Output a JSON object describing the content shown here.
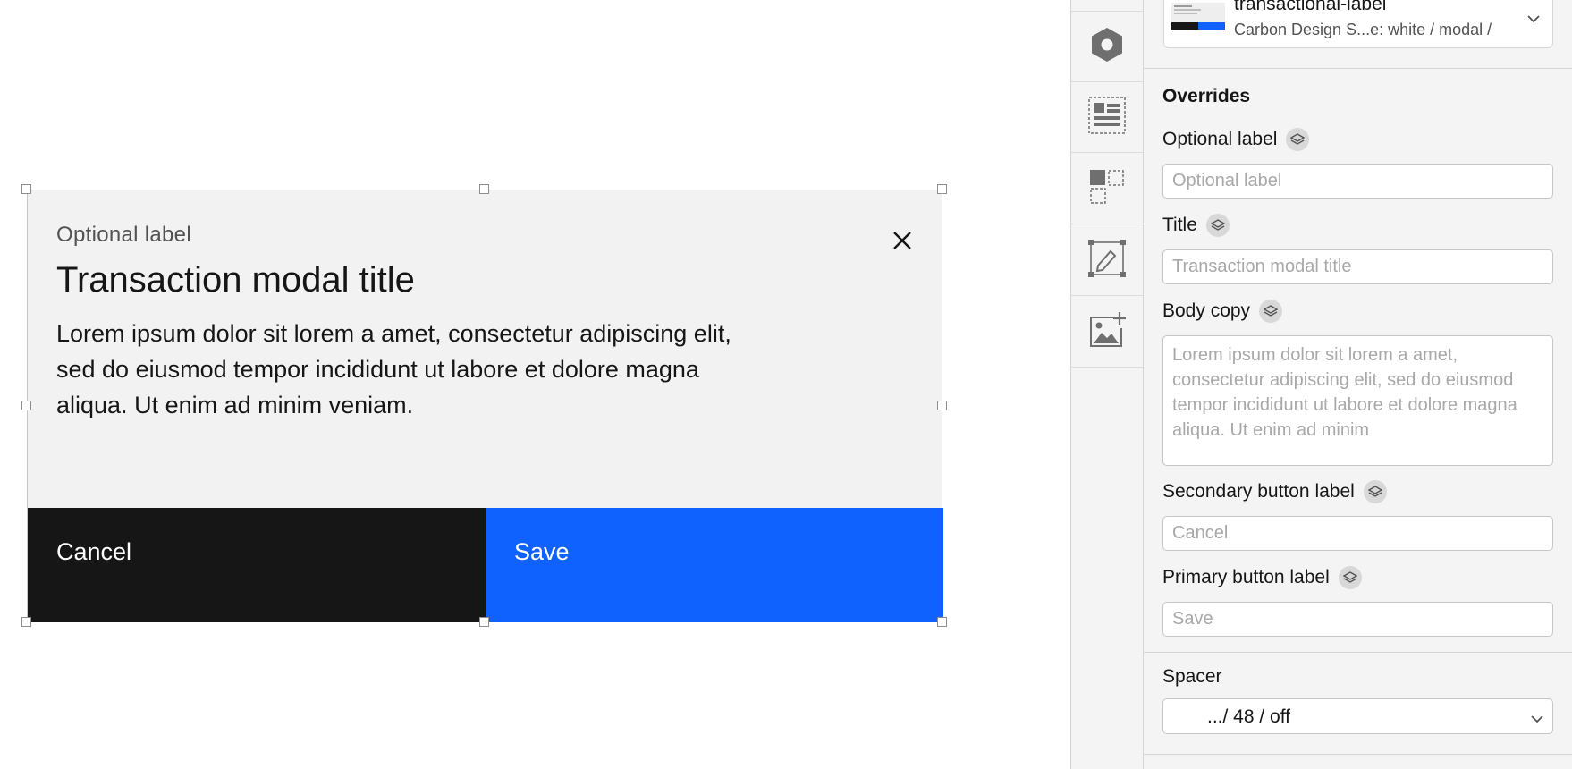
{
  "modal": {
    "optional_label": "Optional label",
    "title": "Transaction modal title",
    "body": "Lorem ipsum dolor sit lorem a amet, consectetur adipiscing elit, sed do eiusmod tempor incididunt ut labore et dolore magna aliqua. Ut enim ad minim veniam.",
    "secondary_button": "Cancel",
    "primary_button": "Save",
    "close_icon": "close-icon"
  },
  "icon_strip": {
    "items": [
      "hexagon-icon",
      "layout-icon",
      "components-icon",
      "edit-frame-icon",
      "add-image-icon"
    ]
  },
  "panel": {
    "component": {
      "name": "transactional-label",
      "path": "Carbon Design S...e: white / modal /"
    },
    "overrides_heading": "Overrides",
    "fields": {
      "optional_label": {
        "label": "Optional label",
        "placeholder": "Optional label"
      },
      "title": {
        "label": "Title",
        "placeholder": "Transaction modal title"
      },
      "body_copy": {
        "label": "Body copy",
        "placeholder": "Lorem ipsum dolor sit lorem a amet, consectetur adipiscing elit, sed do eiusmod tempor incididunt ut labore et dolore magna aliqua. Ut enim ad minim"
      },
      "secondary_button_label": {
        "label": "Secondary button label",
        "placeholder": "Cancel"
      },
      "primary_button_label": {
        "label": "Primary button label",
        "placeholder": "Save"
      }
    },
    "spacer": {
      "label": "Spacer",
      "value": ".../ 48 / off"
    }
  },
  "colors": {
    "primary": "#0f62fe",
    "secondary": "#161616",
    "modal_bg": "#f2f2f2",
    "panel_bg": "#f4f4f4"
  }
}
